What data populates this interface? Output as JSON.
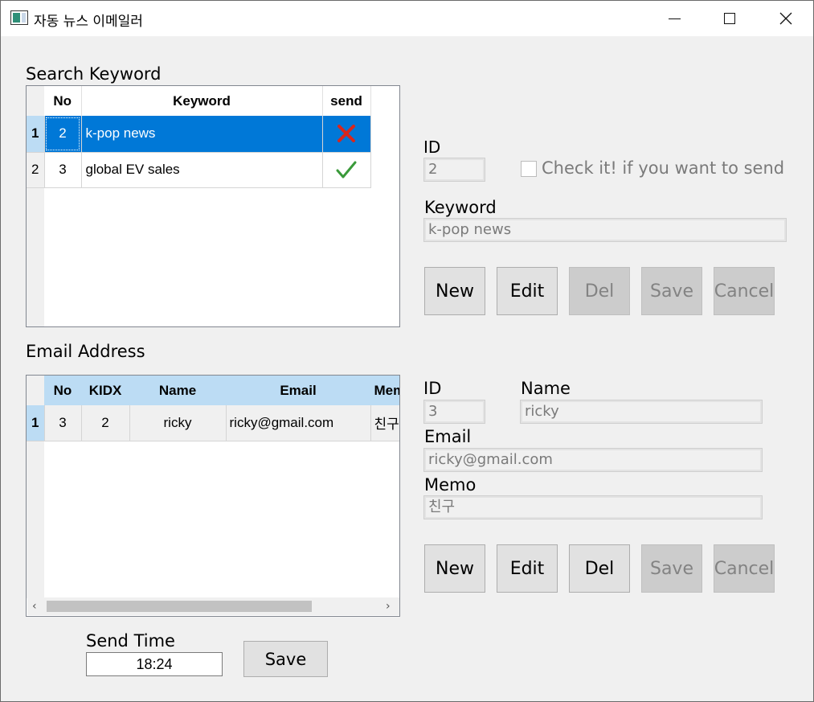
{
  "window": {
    "title": "자동 뉴스 이메일러"
  },
  "keyword_section": {
    "title": "Search Keyword",
    "columns": [
      "No",
      "Keyword",
      "send"
    ],
    "rows": [
      {
        "row_header": "1",
        "no": "2",
        "keyword": "k-pop news",
        "send": "x-mark-icon",
        "selected": true
      },
      {
        "row_header": "2",
        "no": "3",
        "keyword": "global EV sales",
        "send": "checkmark-icon",
        "selected": false
      }
    ]
  },
  "keyword_form": {
    "id_label": "ID",
    "id_value": "2",
    "check_label": "Check it! if you want to send",
    "keyword_label": "Keyword",
    "keyword_value": "k-pop news",
    "buttons": {
      "new": "New",
      "edit": "Edit",
      "del": "Del",
      "save": "Save",
      "cancel": "Cancel"
    }
  },
  "email_section": {
    "title": "Email Address",
    "columns": [
      "No",
      "KIDX",
      "Name",
      "Email",
      "Memo"
    ],
    "rows": [
      {
        "row_header": "1",
        "no": "3",
        "kidx": "2",
        "name": "ricky",
        "email": "ricky@gmail.com",
        "memo": "친구"
      }
    ]
  },
  "email_form": {
    "id_label": "ID",
    "id_value": "3",
    "name_label": "Name",
    "name_value": "ricky",
    "email_label": "Email",
    "email_value": "ricky@gmail.com",
    "memo_label": "Memo",
    "memo_value": "친구",
    "buttons": {
      "new": "New",
      "edit": "Edit",
      "del": "Del",
      "save": "Save",
      "cancel": "Cancel"
    }
  },
  "send_time": {
    "label": "Send Time",
    "value": "18:24",
    "save_label": "Save"
  },
  "colors": {
    "selection": "#0078d7",
    "header_highlight": "#bcdcf4",
    "check_green": "#3a9a3a",
    "x_red": "#d9261c"
  }
}
